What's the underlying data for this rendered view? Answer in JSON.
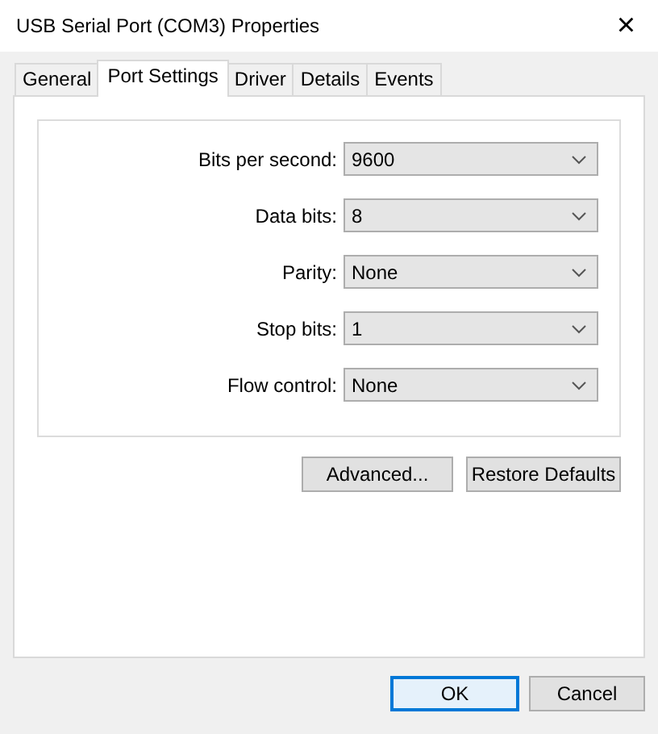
{
  "window": {
    "title": "USB Serial Port (COM3) Properties",
    "close": "×"
  },
  "tabs": [
    {
      "label": "General",
      "selected": false
    },
    {
      "label": "Port Settings",
      "selected": true
    },
    {
      "label": "Driver",
      "selected": false
    },
    {
      "label": "Details",
      "selected": false
    },
    {
      "label": "Events",
      "selected": false
    }
  ],
  "settings": [
    {
      "label": "Bits per second:",
      "value": "9600"
    },
    {
      "label": "Data bits:",
      "value": "8"
    },
    {
      "label": "Parity:",
      "value": "None"
    },
    {
      "label": "Stop bits:",
      "value": "1"
    },
    {
      "label": "Flow control:",
      "value": "None"
    }
  ],
  "panel_buttons": [
    "Advanced...",
    "Restore Defaults"
  ],
  "dialog_buttons": [
    {
      "label": "OK",
      "default": true
    },
    {
      "label": "Cancel",
      "default": false
    }
  ]
}
